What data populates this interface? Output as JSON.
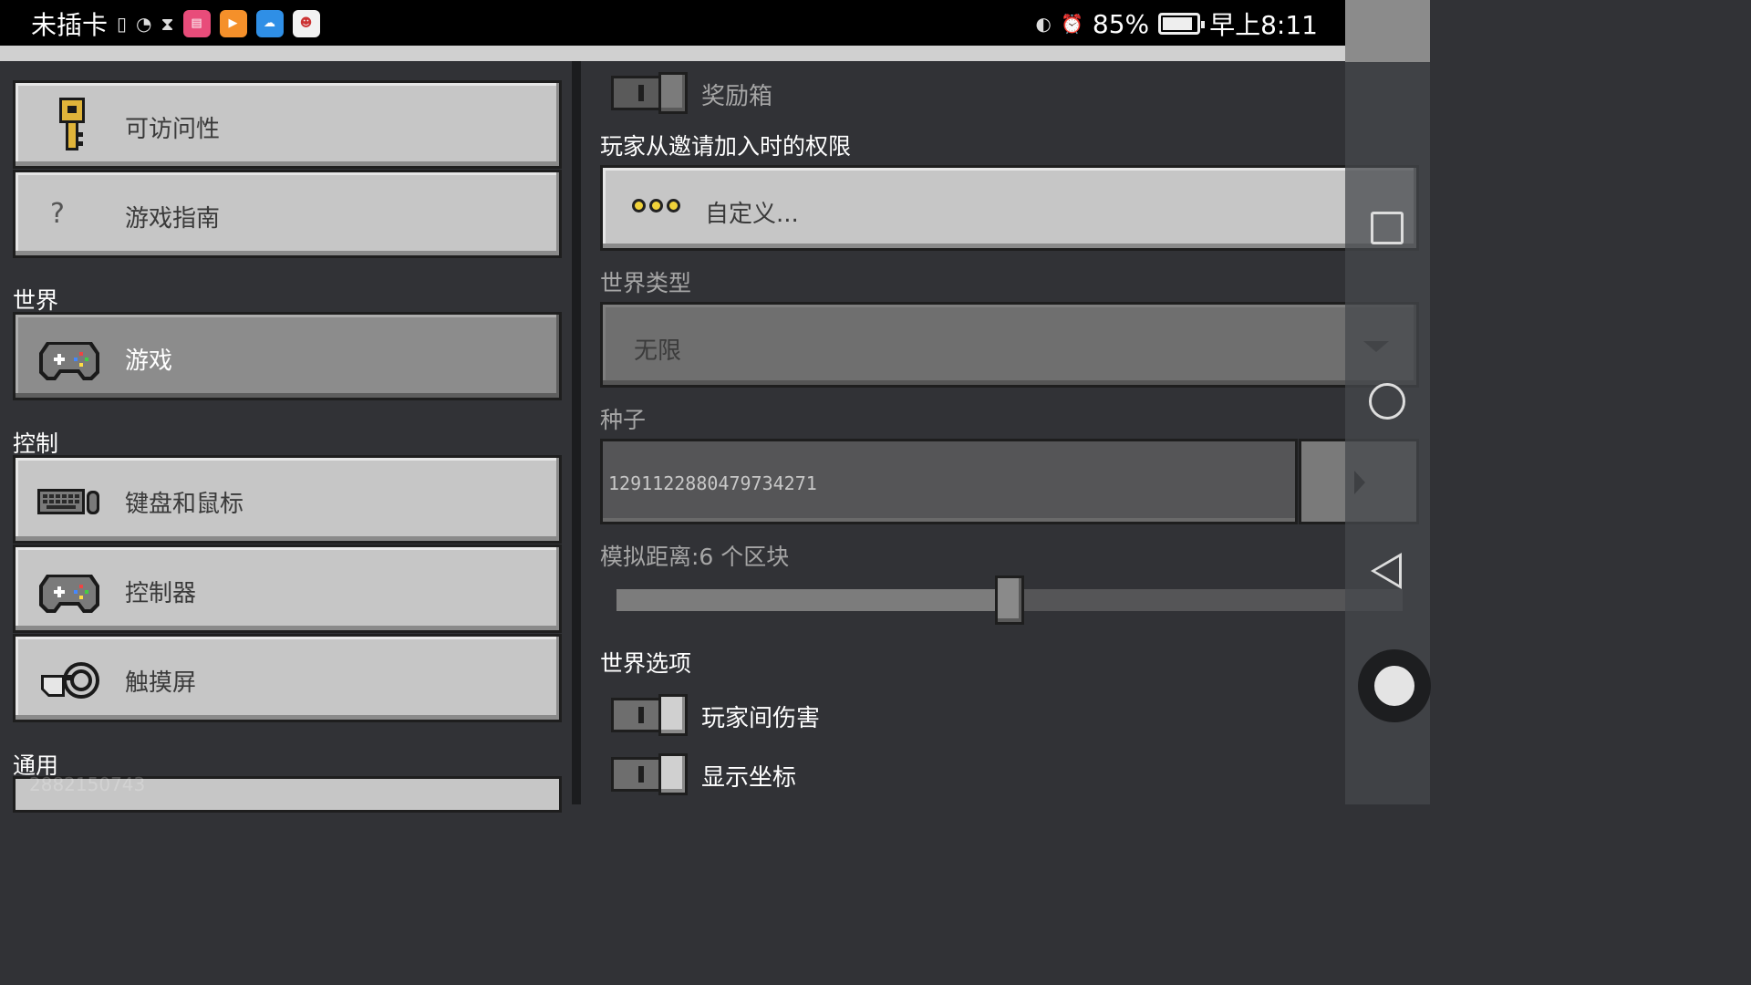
{
  "status_bar": {
    "carrier": "未插卡",
    "battery": "85%",
    "time": "早上8:11"
  },
  "left_panel": {
    "top_items": [
      {
        "label": "可访问性",
        "icon": "key-icon"
      },
      {
        "label": "游戏指南",
        "icon": "question-icon"
      }
    ],
    "world_section": "世界",
    "world_items": [
      {
        "label": "游戏",
        "icon": "gamepad-icon",
        "active": true
      }
    ],
    "controls_section": "控制",
    "controls_items": [
      {
        "label": "键盘和鼠标",
        "icon": "keyboard-mouse-icon"
      },
      {
        "label": "控制器",
        "icon": "gamepad-icon"
      },
      {
        "label": "触摸屏",
        "icon": "touch-hand-icon"
      }
    ],
    "general_section": "通用",
    "watermark": "2882150743"
  },
  "right_panel": {
    "bonus_chest": {
      "label": "奖励箱",
      "on": false
    },
    "invite_permission": {
      "label": "玩家从邀请加入时的权限",
      "value": "自定义..."
    },
    "world_type": {
      "label": "世界类型",
      "value": "无限"
    },
    "seed": {
      "label": "种子",
      "value": "1291122880479734271"
    },
    "sim_distance": {
      "label": "模拟距离:6 个区块",
      "value": 6,
      "min": 4,
      "max": 12,
      "fraction": 0.5
    },
    "world_options": {
      "label": "世界选项",
      "toggles": [
        {
          "label": "玩家间伤害",
          "on": true
        },
        {
          "label": "显示坐标",
          "on": true
        }
      ]
    }
  },
  "colors": {
    "background": "#313236",
    "button_light": "#c6c6c6",
    "button_active": "#8c8c8c",
    "status_bar": "#000000"
  }
}
